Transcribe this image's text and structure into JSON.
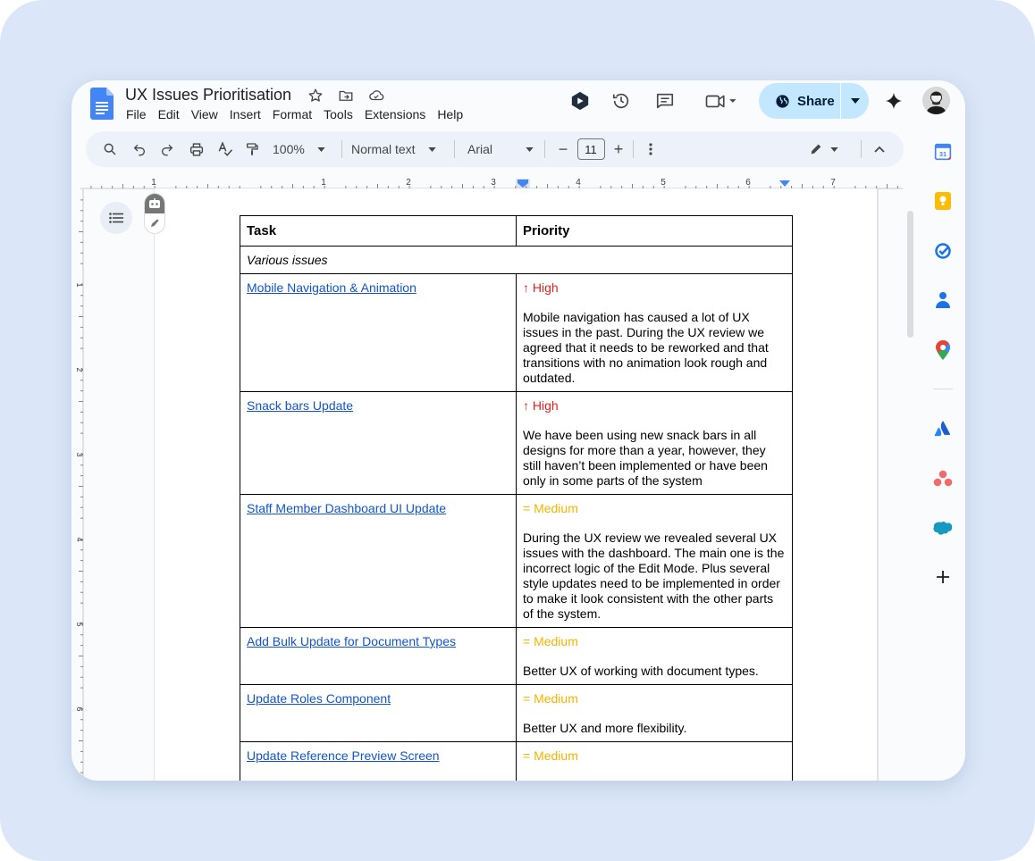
{
  "document": {
    "title": "UX Issues Prioritisation",
    "menu": [
      "File",
      "Edit",
      "View",
      "Insert",
      "Format",
      "Tools",
      "Extensions",
      "Help"
    ]
  },
  "share": {
    "label": "Share"
  },
  "toolbar": {
    "zoom": "100%",
    "style": "Normal text",
    "font": "Arial",
    "font_size": "11",
    "minus": "−",
    "plus": "+"
  },
  "ruler": {
    "labels": [
      "1",
      "1",
      "2",
      "3",
      "4",
      "5",
      "6",
      "7"
    ]
  },
  "vruler": {
    "labels": [
      "1",
      "2",
      "3",
      "4",
      "5",
      "6"
    ]
  },
  "table": {
    "headers": [
      "Task",
      "Priority"
    ],
    "section_label": "Various issues",
    "rows": [
      {
        "task": "Mobile Navigation & Animation",
        "priority": "↑ High",
        "level": "high",
        "description": "Mobile navigation has caused a lot of UX issues in the past. During the UX review we agreed that it needs to be reworked and that transitions with no animation look rough and outdated."
      },
      {
        "task": "Snack bars Update",
        "priority": "↑ High",
        "level": "high",
        "description": "We have been using new snack bars in all designs for more than a year, however, they still haven’t been implemented or have been only in some parts of the system"
      },
      {
        "task": "Staff Member Dashboard UI Update",
        "priority": "= Medium",
        "level": "medium",
        "description": "During the UX review we revealed several UX issues with the dashboard. The main one is the incorrect logic of the Edit Mode. Plus several style updates need to be implemented in order to make it look consistent with the other parts of the system."
      },
      {
        "task": "Add Bulk Update for Document Types",
        "priority": "= Medium",
        "level": "medium",
        "description": "Better UX of working with document types."
      },
      {
        "task": "Update Roles Component",
        "priority": "= Medium",
        "level": "medium",
        "description": "Better UX and more flexibility."
      },
      {
        "task": "Update Reference Preview Screen",
        "priority": "= Medium",
        "level": "medium",
        "description": ""
      }
    ]
  },
  "colors": {
    "high": "#e8201a",
    "medium": "#f4b400",
    "link": "#1155cc",
    "share_bg": "#c2e7ff",
    "toolbar_bg": "#edf2fa",
    "backdrop": "#dbe7f8"
  },
  "icons": {
    "title": [
      "star-icon",
      "move-folder-icon",
      "cloud-saved-icon"
    ],
    "top_right": [
      "gemini-shortcut-icon",
      "history-icon",
      "comments-icon",
      "meet-icon",
      "sparkle-icon"
    ],
    "toolbar": [
      "search-icon",
      "undo-icon",
      "redo-icon",
      "print-icon",
      "spellcheck-icon",
      "paint-format-icon",
      "more-vert-icon",
      "edit-mode-icon",
      "collapse-icon"
    ],
    "side_panel": [
      "calendar-icon",
      "keep-icon",
      "tasks-icon",
      "contacts-icon",
      "maps-icon",
      "atlassian-icon",
      "asana-icon",
      "salesforce-icon",
      "add-icon"
    ]
  }
}
